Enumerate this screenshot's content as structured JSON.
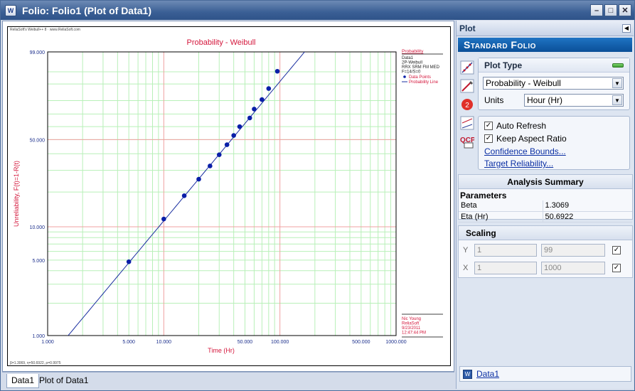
{
  "window": {
    "title": "Folio: Folio1 (Plot of Data1)"
  },
  "plot": {
    "corner_text": "ReliaSoft's Weibull++ 8 · www.ReliaSoft.com",
    "bottom_text": "β=1.3069, η=50.6922, ρ=0.9975",
    "legend": {
      "heading": "Probability",
      "lines": [
        "Data1",
        "2P-Weibull",
        "RRX SRM FM MED",
        "F=14/S=0"
      ],
      "items": [
        "Data Points",
        "Probability Line"
      ]
    },
    "signature": [
      "Nic Young",
      "ReliaSoft",
      "9/23/2011",
      "12:47:44 PM"
    ]
  },
  "chart_data": {
    "type": "scatter",
    "title": "Probability - Weibull",
    "xlabel": "Time (Hr)",
    "ylabel": "Unreliability, F(t)=1-R(t)",
    "xscale": "log",
    "yscale": "weibull",
    "xlim": [
      1,
      1000
    ],
    "ylim": [
      1,
      99
    ],
    "x_ticks": [
      "1.000",
      "5.000",
      "10.000",
      "50.000",
      "100.000",
      "500.000",
      "1000.000"
    ],
    "y_ticks": [
      "1.000",
      "5.000",
      "10.000",
      "50.000",
      "99.000"
    ],
    "series": [
      {
        "name": "Data Points",
        "type": "scatter",
        "x": [
          5,
          10,
          15,
          20,
          25,
          30,
          35,
          40,
          45,
          55,
          60,
          70,
          80,
          95
        ],
        "y": [
          4.83,
          11.72,
          18.62,
          25.52,
          32.41,
          39.31,
          46.21,
          53.1,
          60.0,
          66.9,
          73.79,
          80.69,
          87.59,
          95.17
        ]
      },
      {
        "name": "Probability Line",
        "type": "line",
        "beta": 1.3069,
        "eta": 50.6922
      }
    ],
    "grid": true
  },
  "tabs": [
    {
      "label": "Data1"
    },
    {
      "label": "Plot of Data1"
    }
  ],
  "side": {
    "header": "Plot",
    "banner": "Standard Folio",
    "plot_type": {
      "title": "Plot Type",
      "selected": "Probability - Weibull",
      "units_label": "Units",
      "units_value": "Hour (Hr)"
    },
    "options": {
      "auto_refresh": "Auto Refresh",
      "keep_aspect": "Keep Aspect Ratio",
      "confidence": "Confidence Bounds...",
      "target": "Target Reliability..."
    },
    "analysis": {
      "title": "Analysis Summary",
      "params_label": "Parameters",
      "rows": [
        {
          "name": "Beta",
          "value": "1.3069"
        },
        {
          "name": "Eta (Hr)",
          "value": "50.6922"
        }
      ]
    },
    "scaling": {
      "title": "Scaling",
      "y_label": "Y",
      "y_min": "1",
      "y_max": "99",
      "x_label": "X",
      "x_min": "1",
      "x_max": "1000"
    },
    "footer_link": "Data1"
  },
  "colors": {
    "title_red": "#d4173c",
    "axis_blue": "#1c2f8c",
    "point_blue": "#0a1fa8",
    "grid_green": "#b8f0b8",
    "grid_red": "#f0a0a0"
  }
}
